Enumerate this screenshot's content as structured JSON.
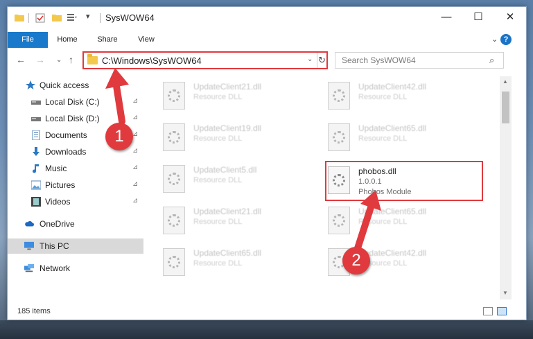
{
  "window": {
    "title": "SysWOW64",
    "controls": {
      "minimize": "—",
      "maximize": "☐",
      "close": "✕"
    }
  },
  "ribbon": {
    "tabs": [
      "File",
      "Home",
      "Share",
      "View"
    ],
    "expand_glyph": "⌄",
    "help_glyph": "?"
  },
  "navbar": {
    "back": "←",
    "forward": "→",
    "recent": "⌄",
    "up": "↑",
    "address": "C:\\Windows\\SysWOW64",
    "address_dropdown": "⌄",
    "refresh": "↻",
    "search_placeholder": "Search SysWOW64",
    "search_glyph": "⌕"
  },
  "sidebar": {
    "items": [
      {
        "label": "Quick access",
        "icon": "star-icon",
        "pinned": false
      },
      {
        "label": "Local Disk (C:)",
        "icon": "drive-icon",
        "pinned": true
      },
      {
        "label": "Local Disk (D:)",
        "icon": "drive-icon",
        "pinned": true
      },
      {
        "label": "Documents",
        "icon": "documents-icon",
        "pinned": true
      },
      {
        "label": "Downloads",
        "icon": "download-icon",
        "pinned": true
      },
      {
        "label": "Music",
        "icon": "music-icon",
        "pinned": true
      },
      {
        "label": "Pictures",
        "icon": "pictures-icon",
        "pinned": true
      },
      {
        "label": "Videos",
        "icon": "videos-icon",
        "pinned": true
      },
      {
        "label": "OneDrive",
        "icon": "cloud-icon",
        "pinned": false
      },
      {
        "label": "This PC",
        "icon": "computer-icon",
        "pinned": false,
        "selected": true
      },
      {
        "label": "Network",
        "icon": "network-icon",
        "pinned": false
      }
    ],
    "pin_glyph": "📌"
  },
  "files": [
    {
      "name": "UpdateClient21.dll",
      "sub": "Resource DLL",
      "col": 0,
      "row": 0
    },
    {
      "name": "UpdateClient42.dll",
      "sub": "Resource DLL",
      "col": 1,
      "row": 0
    },
    {
      "name": "UpdateClient19.dll",
      "sub": "Resource DLL",
      "col": 0,
      "row": 1
    },
    {
      "name": "UpdateClient65.dll",
      "sub": "Resource DLL",
      "col": 1,
      "row": 1
    },
    {
      "name": "UpdateClient5.dll",
      "sub": "Resource DLL",
      "col": 0,
      "row": 2
    },
    {
      "name": "phobos.dll",
      "sub": "1.0.0.1",
      "sub2": "Phobos Module",
      "col": 1,
      "row": 2,
      "highlighted": true
    },
    {
      "name": "UpdateClient21.dll",
      "sub": "Resource DLL",
      "col": 0,
      "row": 3
    },
    {
      "name": "UpdateClient65.dll",
      "sub": "Resource DLL",
      "col": 1,
      "row": 3
    },
    {
      "name": "UpdateClient65.dll",
      "sub": "Resource DLL",
      "col": 0,
      "row": 4
    },
    {
      "name": "UpdateClient42.dll",
      "sub": "Resource DLL",
      "col": 1,
      "row": 4
    }
  ],
  "status": {
    "item_count": "185 items"
  },
  "annotations": [
    {
      "label": "1",
      "color": "#e03a3e"
    },
    {
      "label": "2",
      "color": "#e03a3e"
    }
  ],
  "colors": {
    "accent": "#1979ca",
    "annotation": "#e03a3e",
    "selection": "#d9d9d9"
  }
}
